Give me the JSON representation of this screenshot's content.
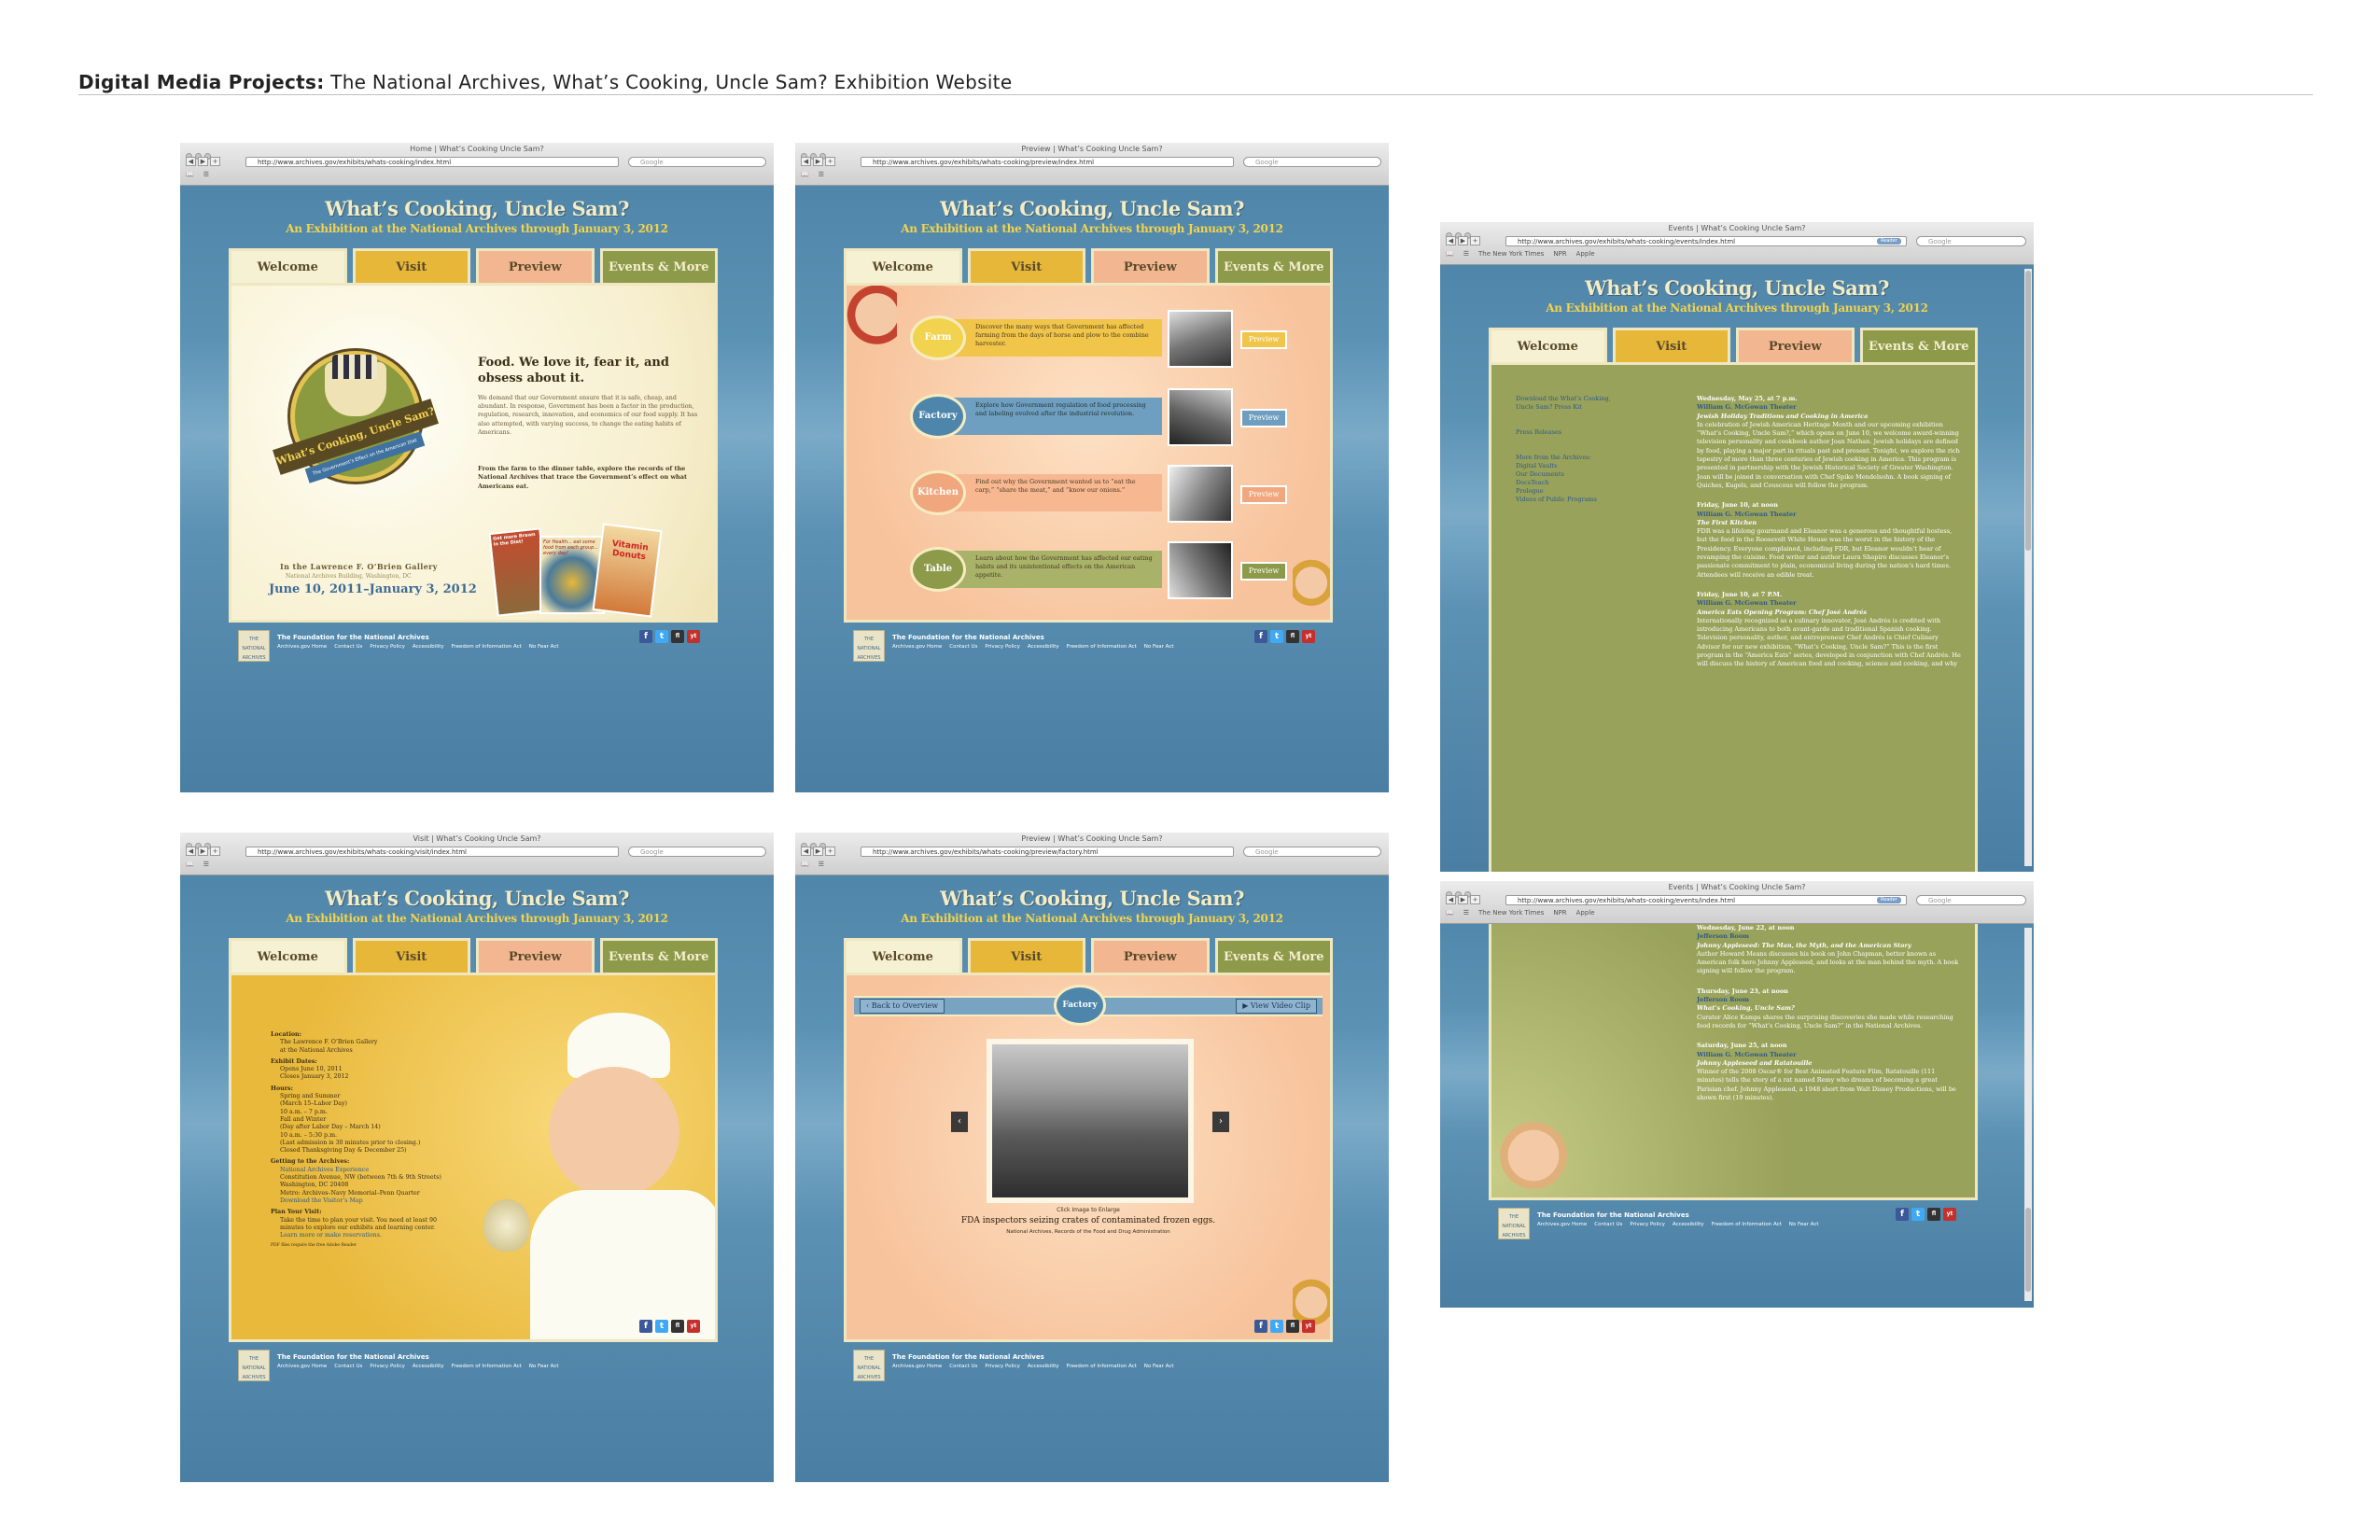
{
  "header": {
    "bold": "Digital Media Projects:",
    "rest": " The National Archives, What’s Cooking, Uncle Sam? Exhibition Website"
  },
  "site": {
    "title": "What’s Cooking, Uncle Sam?",
    "subtitle": "An Exhibition at the National Archives through January 3, 2012",
    "tabs": {
      "welcome": "Welcome",
      "visit": "Visit",
      "preview": "Preview",
      "events": "Events & More"
    },
    "footer": {
      "foundation": "The Foundation for the National Archives",
      "links": [
        "Archives.gov Home",
        "Contact Us",
        "Privacy Policy",
        "Accessibility",
        "Freedom of Information Act",
        "No Fear Act"
      ],
      "logo": "THE NATIONAL ARCHIVES"
    },
    "social": [
      "f",
      "t",
      "fl",
      "yt"
    ]
  },
  "browser": {
    "search_placeholder": "Google",
    "bookmarks": [
      "The New York Times",
      "NPR",
      "Apple"
    ]
  },
  "shots": {
    "home": {
      "title": "Home | What’s Cooking Uncle Sam?",
      "url": "http://www.archives.gov/exhibits/whats-cooking/index.html",
      "heading": "Food. We love it, fear it, and obsess about it.",
      "body1": "We demand that our Government ensure that it is safe, cheap, and abundant. In response, Government has been a factor in the production, regulation, research, innovation, and economics of our food supply. It has also attempted, with varying success, to change the eating habits of Americans.",
      "body2": "From the farm to the dinner table, explore the records of the National Archives that trace the Government’s effect on what Americans eat.",
      "badge": "What’s Cooking, Uncle Sam?",
      "badge_ribbon": "The Government’s Effect on the American Diet",
      "poster1": "Get more Brawn in the Diet!",
      "poster2": "For Health... eat some food from each group... every day!",
      "poster3": "Vitamin Donuts",
      "gallery1": "In the Lawrence F. O’Brien Gallery",
      "gallery2": "National Archives Building, Washington, DC",
      "dates": "June 10, 2011–January 3, 2012"
    },
    "preview": {
      "title": "Preview | What’s Cooking Uncle Sam?",
      "url": "http://www.archives.gov/exhibits/whats-cooking/preview/index.html",
      "rows": [
        {
          "label": "Farm",
          "text": "Discover the many ways that Government has affected farming from the days of horse and plow to the combine harvester.",
          "btn": "Preview"
        },
        {
          "label": "Factory",
          "text": "Explore how Government regulation of food processing and labeling evolved after the industrial revolution.",
          "btn": "Preview"
        },
        {
          "label": "Kitchen",
          "text": "Find out why the Government wanted us to “eat the carp,” “share the meat,” and “know our onions.”",
          "btn": "Preview"
        },
        {
          "label": "Table",
          "text": "Learn about how the Government has affected our eating habits and its unintentional effects on the American appetite.",
          "btn": "Preview"
        }
      ]
    },
    "visit": {
      "title": "Visit | What’s Cooking Uncle Sam?",
      "url": "http://www.archives.gov/exhibits/whats-cooking/visit/index.html",
      "lines": [
        {
          "h": "Location:"
        },
        {
          "t": "The Lawrence F. O’Brien Gallery"
        },
        {
          "t": "at the National Archives"
        },
        {
          "h": "Exhibit Dates:"
        },
        {
          "t": "Opens June 10, 2011"
        },
        {
          "t": "Closes January 3, 2012"
        },
        {
          "h": "Hours:"
        },
        {
          "t": "Spring and Summer"
        },
        {
          "t": "(March 15–Labor Day)"
        },
        {
          "t": "10 a.m. – 7 p.m."
        },
        {
          "t": " "
        },
        {
          "t": "Fall and Winter"
        },
        {
          "t": "(Day after Labor Day – March 14)"
        },
        {
          "t": "10 a.m. – 5:30 p.m."
        },
        {
          "t": "(Last admission is 30 minutes prior to closing.)"
        },
        {
          "t": "Closed Thanksgiving Day & December 25)"
        },
        {
          "h": "Getting to the Archives:"
        },
        {
          "l": "National Archives Experience"
        },
        {
          "t": "Constitution Avenue, NW (between 7th & 9th Streets)"
        },
        {
          "t": "Washington, DC 20408"
        },
        {
          "t": " "
        },
        {
          "t": "Metro: Archives–Navy Memorial–Penn Quarter"
        },
        {
          "l": "Download the Visitor’s Map"
        },
        {
          "h": "Plan Your Visit:"
        },
        {
          "t": "Take the time to plan your visit. You need at least 90"
        },
        {
          "t": "minutes to explore our exhibits and learning center."
        },
        {
          "l": "Learn more or make reservations."
        },
        {
          "s": "PDF files require the free Adobe Reader"
        }
      ]
    },
    "factory": {
      "title": "Preview | What’s Cooking Uncle Sam?",
      "url": "http://www.archives.gov/exhibits/whats-cooking/preview/factory.html",
      "back": "Back to Overview",
      "label": "Factory",
      "video": "View Video Clip",
      "enlarge": "Click Image to Enlarge",
      "caption": "FDA inspectors seizing crates of contaminated frozen eggs.",
      "credit": "National Archives, Records of the Food and Drug Administration"
    },
    "events1": {
      "title": "Events | What’s Cooking Uncle Sam?",
      "url": "http://www.archives.gov/exhibits/whats-cooking/events/index.html",
      "reader": "Reader",
      "side": [
        "Download the What’s Cooking, Uncle Sam? Press Kit",
        "Press Releases",
        "More from the Archives:",
        "Digital Vaults",
        "Our Documents",
        "DocsTeach",
        "Prologue",
        "Videos of Public Programs"
      ],
      "events": [
        {
          "date": "Wednesday, May 25, at 7 p.m.",
          "place": "William G. McGowan Theater",
          "name": "Jewish Holiday Traditions and Cooking in America",
          "desc": "In celebration of Jewish American Heritage Month and our upcoming exhibition “What’s Cooking, Uncle Sam?,” which opens on June 10, we welcome award-winning television personality and cookbook author Joan Nathan. Jewish holidays are defined by food, playing a major part in rituals past and present. Tonight, we explore the rich tapestry of more than three centuries of Jewish cooking in America. This program is presented in partnership with the Jewish Historical Society of Greater Washington. Joan will be joined in conversation with Chef Spike Mendelsohn. A book signing of Quiches, Kugels, and Couscous will follow the program."
        },
        {
          "date": "Friday, June 10, at noon",
          "place": "William G. McGowan Theater",
          "name": "The First Kitchen",
          "desc": "FDR was a lifelong gourmand and Eleanor was a generous and thoughtful hostess, but the food in the Roosevelt White House was the worst in the history of the Presidency. Everyone complained, including FDR, but Eleanor wouldn’t hear of revamping the cuisine. Food writer and author Laura Shapiro discusses Eleanor’s passionate commitment to plain, economical living during the nation’s hard times. Attendees will receive an edible treat."
        },
        {
          "date": "Friday, June 10, at 7 P.M.",
          "place": "William G. McGowan Theater",
          "name": "America Eats Opening Program: Chef José Andrés",
          "desc": "Internationally recognized as a culinary innovator, José Andrés is credited with introducing Americans to both avant-garde and traditional Spanish cooking. Television personality, author, and entrepreneur Chef Andrés is Chief Culinary Advisor for our new exhibition, “What’s Cooking, Uncle Sam?” This is the first program in the “America Eats” series, developed in conjunction with Chef Andrés. He will discuss the history of American food and cooking, science and cooking, and why"
        }
      ]
    },
    "events2": {
      "title": "Events | What’s Cooking Uncle Sam?",
      "url": "http://www.archives.gov/exhibits/whats-cooking/events/index.html",
      "reader": "Reader",
      "events": [
        {
          "date": "Wednesday, June 22, at noon",
          "place": "Jefferson Room",
          "name": "Johnny Appleseed: The Man, the Myth, and the American Story",
          "desc": "Author Howard Means discusses his book on John Chapman, better known as American folk hero Johnny Appleseed, and looks at the man behind the myth. A book signing will follow the program."
        },
        {
          "date": "Thursday, June 23, at noon",
          "place": "Jefferson Room",
          "name": "What’s Cooking, Uncle Sam?",
          "desc": "Curator Alice Kamps shares the surprising discoveries she made while researching food records for “What’s Cooking, Uncle Sam?” in the National Archives."
        },
        {
          "date": "Saturday, June 25, at noon",
          "place": "William G. McGowan Theater",
          "name": "Johnny Appleseed and Ratatouille",
          "desc": "Winner of the 2008 Oscar® for Best Animated Feature Film, Ratatouille (111 minutes) tells the story of a rat named Remy who dreams of becoming a great Parisian chef. Johnny Appleseed, a 1948 short from Walt Disney Productions, will be shown first (19 minutes)."
        }
      ]
    }
  }
}
